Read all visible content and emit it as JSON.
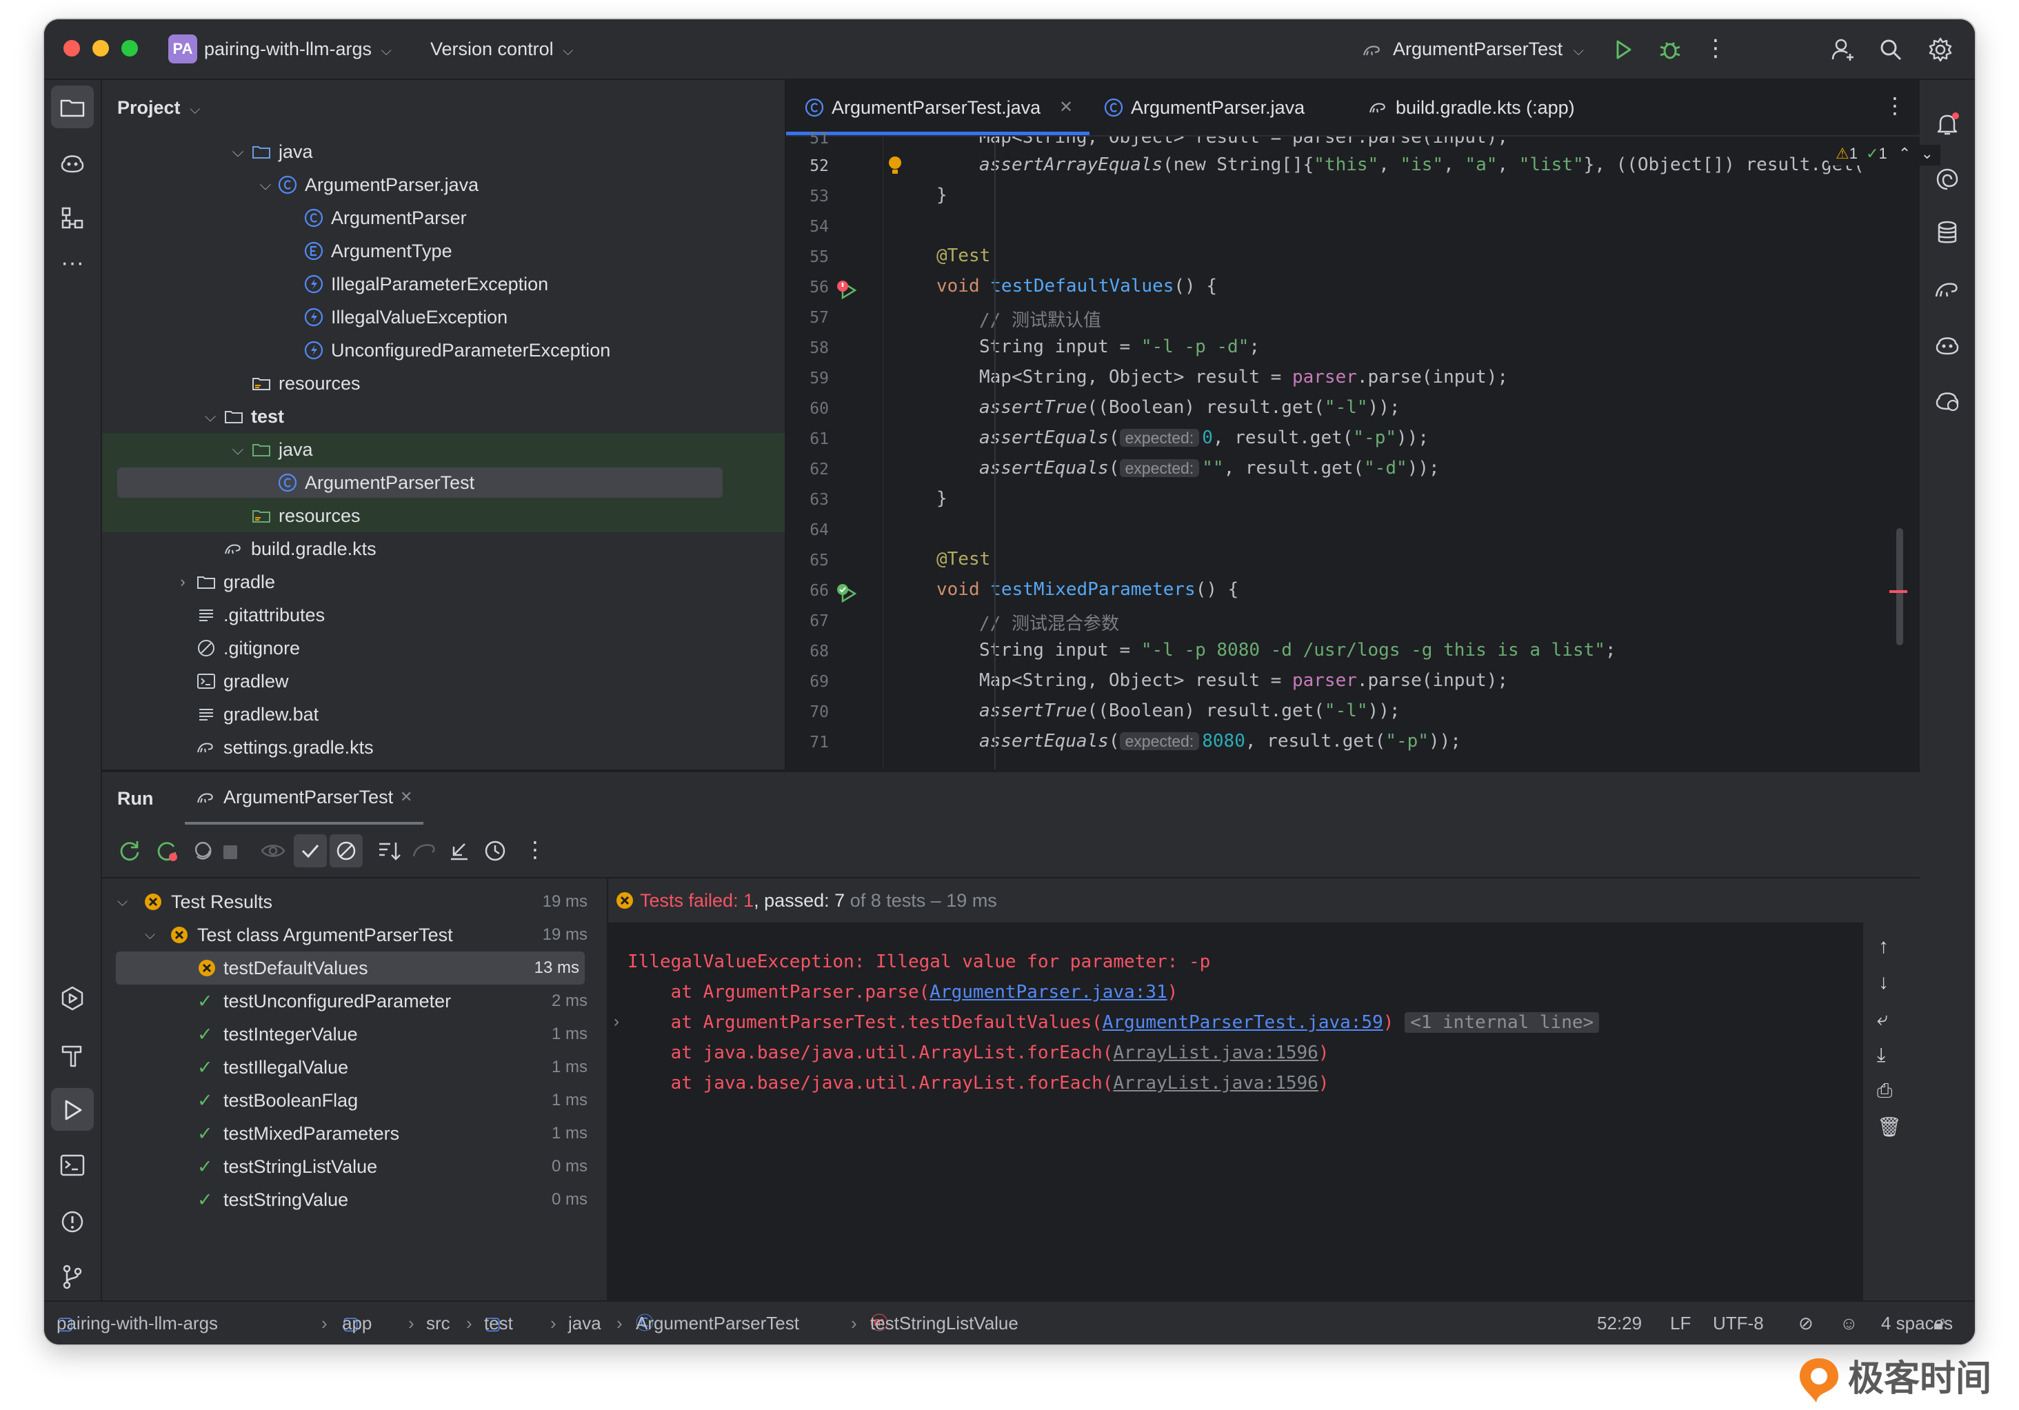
{
  "titlebar": {
    "project_badge": "PA",
    "project_name": "pairing-with-llm-args",
    "vcs": "Version control",
    "run_config": "ArgumentParserTest"
  },
  "project_panel": {
    "title": "Project",
    "tree": [
      {
        "label": "java",
        "kind": "folder",
        "expanded": true
      },
      {
        "label": "ArgumentParser.java",
        "kind": "class-file",
        "expanded": true
      },
      {
        "label": "ArgumentParser",
        "kind": "class"
      },
      {
        "label": "ArgumentType",
        "kind": "enum"
      },
      {
        "label": "IllegalParameterException",
        "kind": "exception"
      },
      {
        "label": "IllegalValueException",
        "kind": "exception"
      },
      {
        "label": "UnconfiguredParameterException",
        "kind": "exception"
      },
      {
        "label": "resources",
        "kind": "resources-folder"
      },
      {
        "label": "test",
        "kind": "folder",
        "expanded": true
      },
      {
        "label": "java",
        "kind": "test-folder",
        "expanded": true
      },
      {
        "label": "ArgumentParserTest",
        "kind": "class",
        "selected": true
      },
      {
        "label": "resources",
        "kind": "test-resources-folder"
      },
      {
        "label": "build.gradle.kts",
        "kind": "gradle-file"
      },
      {
        "label": "gradle",
        "kind": "folder",
        "expanded": false
      },
      {
        "label": ".gitattributes",
        "kind": "text-file"
      },
      {
        "label": ".gitignore",
        "kind": "ignore-file"
      },
      {
        "label": "gradlew",
        "kind": "shell-file"
      },
      {
        "label": "gradlew.bat",
        "kind": "text-file"
      },
      {
        "label": "settings.gradle.kts",
        "kind": "gradle-file"
      }
    ]
  },
  "editor": {
    "tabs": [
      {
        "label": "ArgumentParserTest.java",
        "active": true
      },
      {
        "label": "ArgumentParser.java",
        "active": false
      },
      {
        "label": "build.gradle.kts (:app)",
        "active": false
      }
    ],
    "inspection": {
      "warnings": "1",
      "ok": "1"
    },
    "line_numbers": [
      "51",
      "52",
      "53",
      "54",
      "55",
      "56",
      "57",
      "58",
      "59",
      "60",
      "61",
      "62",
      "63",
      "64",
      "65",
      "66",
      "67",
      "68",
      "69",
      "70",
      "71"
    ],
    "code": {
      "l51": "Map<String, Object> result = parser.parse(input);",
      "l52a": "assertArrayEquals",
      "l52b": "(new String[]{",
      "l52c": "\"this\"",
      "l52d": ", ",
      "l52e": "\"is\"",
      "l52f": "\"a\"",
      "l52g": "\"list\"",
      "l52h": "}, ((Object[]) result.get(",
      "l53": "}",
      "l55": "@Test",
      "l56a": "void ",
      "l56b": "testDefaultValues",
      "l56c": "() {",
      "l57": "// 测试默认值",
      "l58a": "String input = ",
      "l58b": "\"-l -p -d\"",
      "l58c": ";",
      "l59a": "Map<String, Object> result = ",
      "l59b": "parser",
      "l59c": ".parse(input);",
      "l60a": "assertTrue",
      "l60b": "((Boolean) result.get(",
      "l60c": "\"-l\"",
      "l60d": "));",
      "l61a": "assertEquals",
      "hint_expected": "expected:",
      "l61b": "0",
      "l61c": ", result.get(",
      "l61d": "\"-p\"",
      "l61e": "));",
      "l62b": "\"\"",
      "l62c": ", result.get(",
      "l62d": "\"-d\"",
      "l62e": "));",
      "l63": "}",
      "l65": "@Test",
      "l66a": "void ",
      "l66b": "testMixedParameters",
      "l66c": "() {",
      "l67": "// 测试混合参数",
      "l68a": "String input = ",
      "l68b": "\"-l -p 8080 -d /usr/logs -g this is a list\"",
      "l68c": ";",
      "l69a": "Map<String, Object> result = ",
      "l69b": "parser",
      "l69c": ".parse(input);",
      "l70a": "assertTrue",
      "l70b": "((Boolean) result.get(",
      "l70c": "\"-l\"",
      "l70d": "));",
      "l71a": "assertEquals",
      "l71b": "8080",
      "l71c": ", result.get(",
      "l71d": "\"-p\"",
      "l71e": "));"
    }
  },
  "run_panel": {
    "title": "Run",
    "tab": "ArgumentParserTest",
    "summary_failed": "Tests failed: 1",
    "summary_sep": ", ",
    "summary_passed": "passed: 7",
    "summary_rest": " of 8 tests – 19 ms",
    "results": [
      {
        "label": "Test Results",
        "time": "19 ms",
        "status": "failed",
        "level": 0
      },
      {
        "label": "Test class ArgumentParserTest",
        "time": "19 ms",
        "status": "failed",
        "level": 1
      },
      {
        "label": "testDefaultValues",
        "time": "13 ms",
        "status": "failed",
        "level": 2,
        "selected": true
      },
      {
        "label": "testUnconfiguredParameter",
        "time": "2 ms",
        "status": "passed",
        "level": 2
      },
      {
        "label": "testIntegerValue",
        "time": "1 ms",
        "status": "passed",
        "level": 2
      },
      {
        "label": "testIllegalValue",
        "time": "1 ms",
        "status": "passed",
        "level": 2
      },
      {
        "label": "testBooleanFlag",
        "time": "1 ms",
        "status": "passed",
        "level": 2
      },
      {
        "label": "testMixedParameters",
        "time": "1 ms",
        "status": "passed",
        "level": 2
      },
      {
        "label": "testStringListValue",
        "time": "0 ms",
        "status": "passed",
        "level": 2
      },
      {
        "label": "testStringValue",
        "time": "0 ms",
        "status": "passed",
        "level": 2
      }
    ],
    "console": {
      "line1": "IllegalValueException: Illegal value for parameter: -p",
      "line2a": "    at ArgumentParser.parse(",
      "line2b": "ArgumentParser.java:31",
      "line2c": ")",
      "line3a": "    at ArgumentParserTest.testDefaultValues(",
      "line3b": "ArgumentParserTest.java:59",
      "line3c": ")",
      "line3d": "<1 internal line>",
      "line4a": "    at java.base/java.util.ArrayList.forEach(",
      "line4b": "ArrayList.java:1596",
      "line4c": ")",
      "line5a": "    at java.base/java.util.ArrayList.forEach(",
      "line5b": "ArrayList.java:1596",
      "line5c": ")"
    }
  },
  "statusbar": {
    "breadcrumbs": [
      "pairing-with-llm-args",
      "app",
      "src",
      "test",
      "java",
      "ArgumentParserTest",
      "testStringListValue"
    ],
    "position": "52:29",
    "line_ending": "LF",
    "encoding": "UTF-8",
    "indent": "4 spaces"
  },
  "watermark": {
    "text": "极客时间"
  },
  "colors": {
    "accent": "#3574f0",
    "error": "#f75464",
    "success": "#5fb865",
    "warning": "#e5a000"
  }
}
